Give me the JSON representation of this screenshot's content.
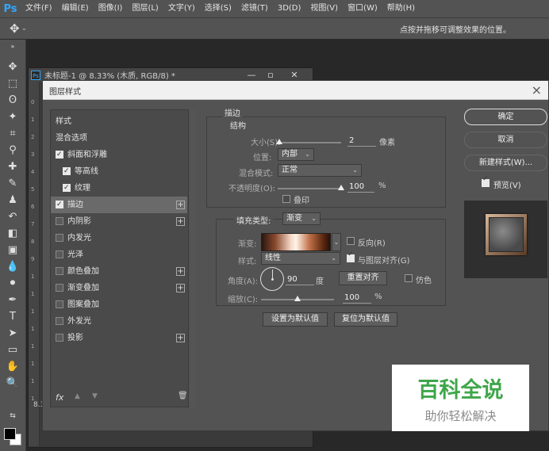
{
  "app": {
    "logo": "Ps",
    "menu": [
      "文件(F)",
      "编辑(E)",
      "图像(I)",
      "图层(L)",
      "文字(Y)",
      "选择(S)",
      "滤镜(T)",
      "3D(D)",
      "视图(V)",
      "窗口(W)",
      "帮助(H)"
    ],
    "options_hint": "点按并拖移可调整效果的位置。"
  },
  "document": {
    "icon_label": "Ps",
    "title": "未标题-1 @ 8.33% (木质, RGB/8) *",
    "status": "8.33%",
    "ruler": [
      "0",
      "1",
      "2",
      "3",
      "4",
      "5",
      "6",
      "7",
      "8",
      "9",
      "1",
      "1",
      "1",
      "1",
      "1",
      "1",
      "1",
      "1"
    ]
  },
  "dialog": {
    "title": "图层样式",
    "styles": [
      {
        "label": "样式",
        "checkbox": false,
        "checked": false,
        "plus": false,
        "indent": 0,
        "selected": false
      },
      {
        "label": "混合选项",
        "checkbox": false,
        "checked": false,
        "plus": false,
        "indent": 0,
        "selected": false
      },
      {
        "label": "斜面和浮雕",
        "checkbox": true,
        "checked": true,
        "plus": false,
        "indent": 0,
        "selected": false
      },
      {
        "label": "等高线",
        "checkbox": true,
        "checked": true,
        "plus": false,
        "indent": 1,
        "selected": false
      },
      {
        "label": "纹理",
        "checkbox": true,
        "checked": true,
        "plus": false,
        "indent": 1,
        "selected": false
      },
      {
        "label": "描边",
        "checkbox": true,
        "checked": true,
        "plus": true,
        "indent": 0,
        "selected": true
      },
      {
        "label": "内阴影",
        "checkbox": true,
        "checked": false,
        "plus": true,
        "indent": 0,
        "selected": false
      },
      {
        "label": "内发光",
        "checkbox": true,
        "checked": false,
        "plus": false,
        "indent": 0,
        "selected": false
      },
      {
        "label": "光泽",
        "checkbox": true,
        "checked": false,
        "plus": false,
        "indent": 0,
        "selected": false
      },
      {
        "label": "颜色叠加",
        "checkbox": true,
        "checked": false,
        "plus": true,
        "indent": 0,
        "selected": false
      },
      {
        "label": "渐变叠加",
        "checkbox": true,
        "checked": false,
        "plus": true,
        "indent": 0,
        "selected": false
      },
      {
        "label": "图案叠加",
        "checkbox": true,
        "checked": false,
        "plus": false,
        "indent": 0,
        "selected": false
      },
      {
        "label": "外发光",
        "checkbox": true,
        "checked": false,
        "plus": false,
        "indent": 0,
        "selected": false
      },
      {
        "label": "投影",
        "checkbox": true,
        "checked": false,
        "plus": true,
        "indent": 0,
        "selected": false
      }
    ],
    "footer": {
      "fx": "fx"
    },
    "stroke": {
      "section_title": "描边",
      "structure_title": "结构",
      "size_label": "大小(S):",
      "size_value": "2",
      "size_unit": "像素",
      "size_level": 0.02,
      "position_label": "位置:",
      "position_value": "内部",
      "blend_label": "混合模式:",
      "blend_value": "正常",
      "opacity_label": "不透明度(O):",
      "opacity_value": "100",
      "opacity_unit": "%",
      "opacity_level": 1.0,
      "overprint_label": "叠印",
      "fill_type_label": "填充类型:",
      "fill_type_value": "渐变",
      "gradient_label": "渐变:",
      "reverse_label": "反向(R)",
      "reverse_checked": false,
      "style_label": "样式:",
      "style_value": "线性",
      "align_label": "与图层对齐(G)",
      "align_checked": true,
      "angle_label": "角度(A):",
      "angle_value": "90",
      "angle_unit": "度",
      "reset_align_label": "重置对齐",
      "dither_label": "仿色",
      "dither_checked": false,
      "scale_label": "缩放(C):",
      "scale_value": "100",
      "scale_unit": "%",
      "scale_level": 0.5,
      "make_default_label": "设置为默认值",
      "reset_default_label": "复位为默认值"
    },
    "buttons": {
      "ok": "确定",
      "cancel": "取消",
      "new_style": "新建样式(W)...",
      "preview": "预览(V)",
      "preview_checked": true
    }
  },
  "watermark": {
    "main": "百科全说",
    "sub": "助你轻松解决"
  }
}
